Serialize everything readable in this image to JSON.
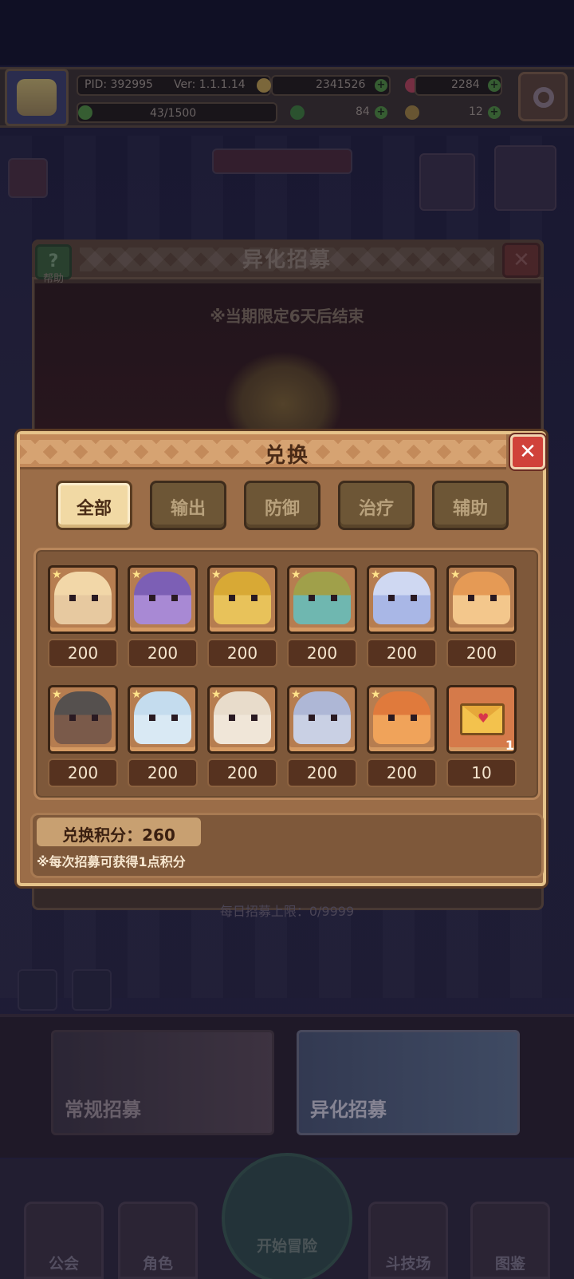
{
  "hud": {
    "pid": "PID: 392995",
    "version": "Ver: 1.1.1.14",
    "gold": "2341526",
    "gems": "2284",
    "stamina": "43/1500",
    "clover": "84",
    "keys": "12"
  },
  "background_panel": {
    "title": "异化招募",
    "help_label": "帮助",
    "close_symbol": "✕",
    "limited_notice": "※当期限定6天后结束",
    "daily_limit": "每日招募上限：0/9999"
  },
  "recruit_cards": [
    {
      "label": "常规招募"
    },
    {
      "label": "异化招募"
    }
  ],
  "bottom_nav": {
    "guild": "公会",
    "character": "角色",
    "adventure": "开始冒险",
    "arena": "斗技场",
    "codex": "图鉴"
  },
  "exchange": {
    "title": "兑换",
    "close_symbol": "✕",
    "tabs": [
      {
        "label": "全部",
        "active": true
      },
      {
        "label": "输出",
        "active": false
      },
      {
        "label": "防御",
        "active": false
      },
      {
        "label": "治疗",
        "active": false
      },
      {
        "label": "辅助",
        "active": false
      }
    ],
    "items": [
      {
        "price": "200",
        "color": "#e7c9a0",
        "hair": "#f2d7a8"
      },
      {
        "price": "200",
        "color": "#a889d4",
        "hair": "#7c5fb5"
      },
      {
        "price": "200",
        "color": "#e8c25a",
        "hair": "#d8a935"
      },
      {
        "price": "200",
        "color": "#6fb7b0",
        "hair": "#a0a04a"
      },
      {
        "price": "200",
        "color": "#a9b7e6",
        "hair": "#cfd8f2"
      },
      {
        "price": "200",
        "color": "#f3c78c",
        "hair": "#e59a55"
      },
      {
        "price": "200",
        "color": "#7a5a4a",
        "hair": "#55504e"
      },
      {
        "price": "200",
        "color": "#d9e9f4",
        "hair": "#c4dcee"
      },
      {
        "price": "200",
        "color": "#f0e6d8",
        "hair": "#e8dccb"
      },
      {
        "price": "200",
        "color": "#c9d0e4",
        "hair": "#aeb7d6"
      },
      {
        "price": "200",
        "color": "#f0a35a",
        "hair": "#e07a3c"
      },
      {
        "price": "10",
        "item": "envelope-icon",
        "quantity": "1"
      }
    ],
    "points_label": "兑换积分：260",
    "note": "※每次招募可获得1点积分"
  }
}
